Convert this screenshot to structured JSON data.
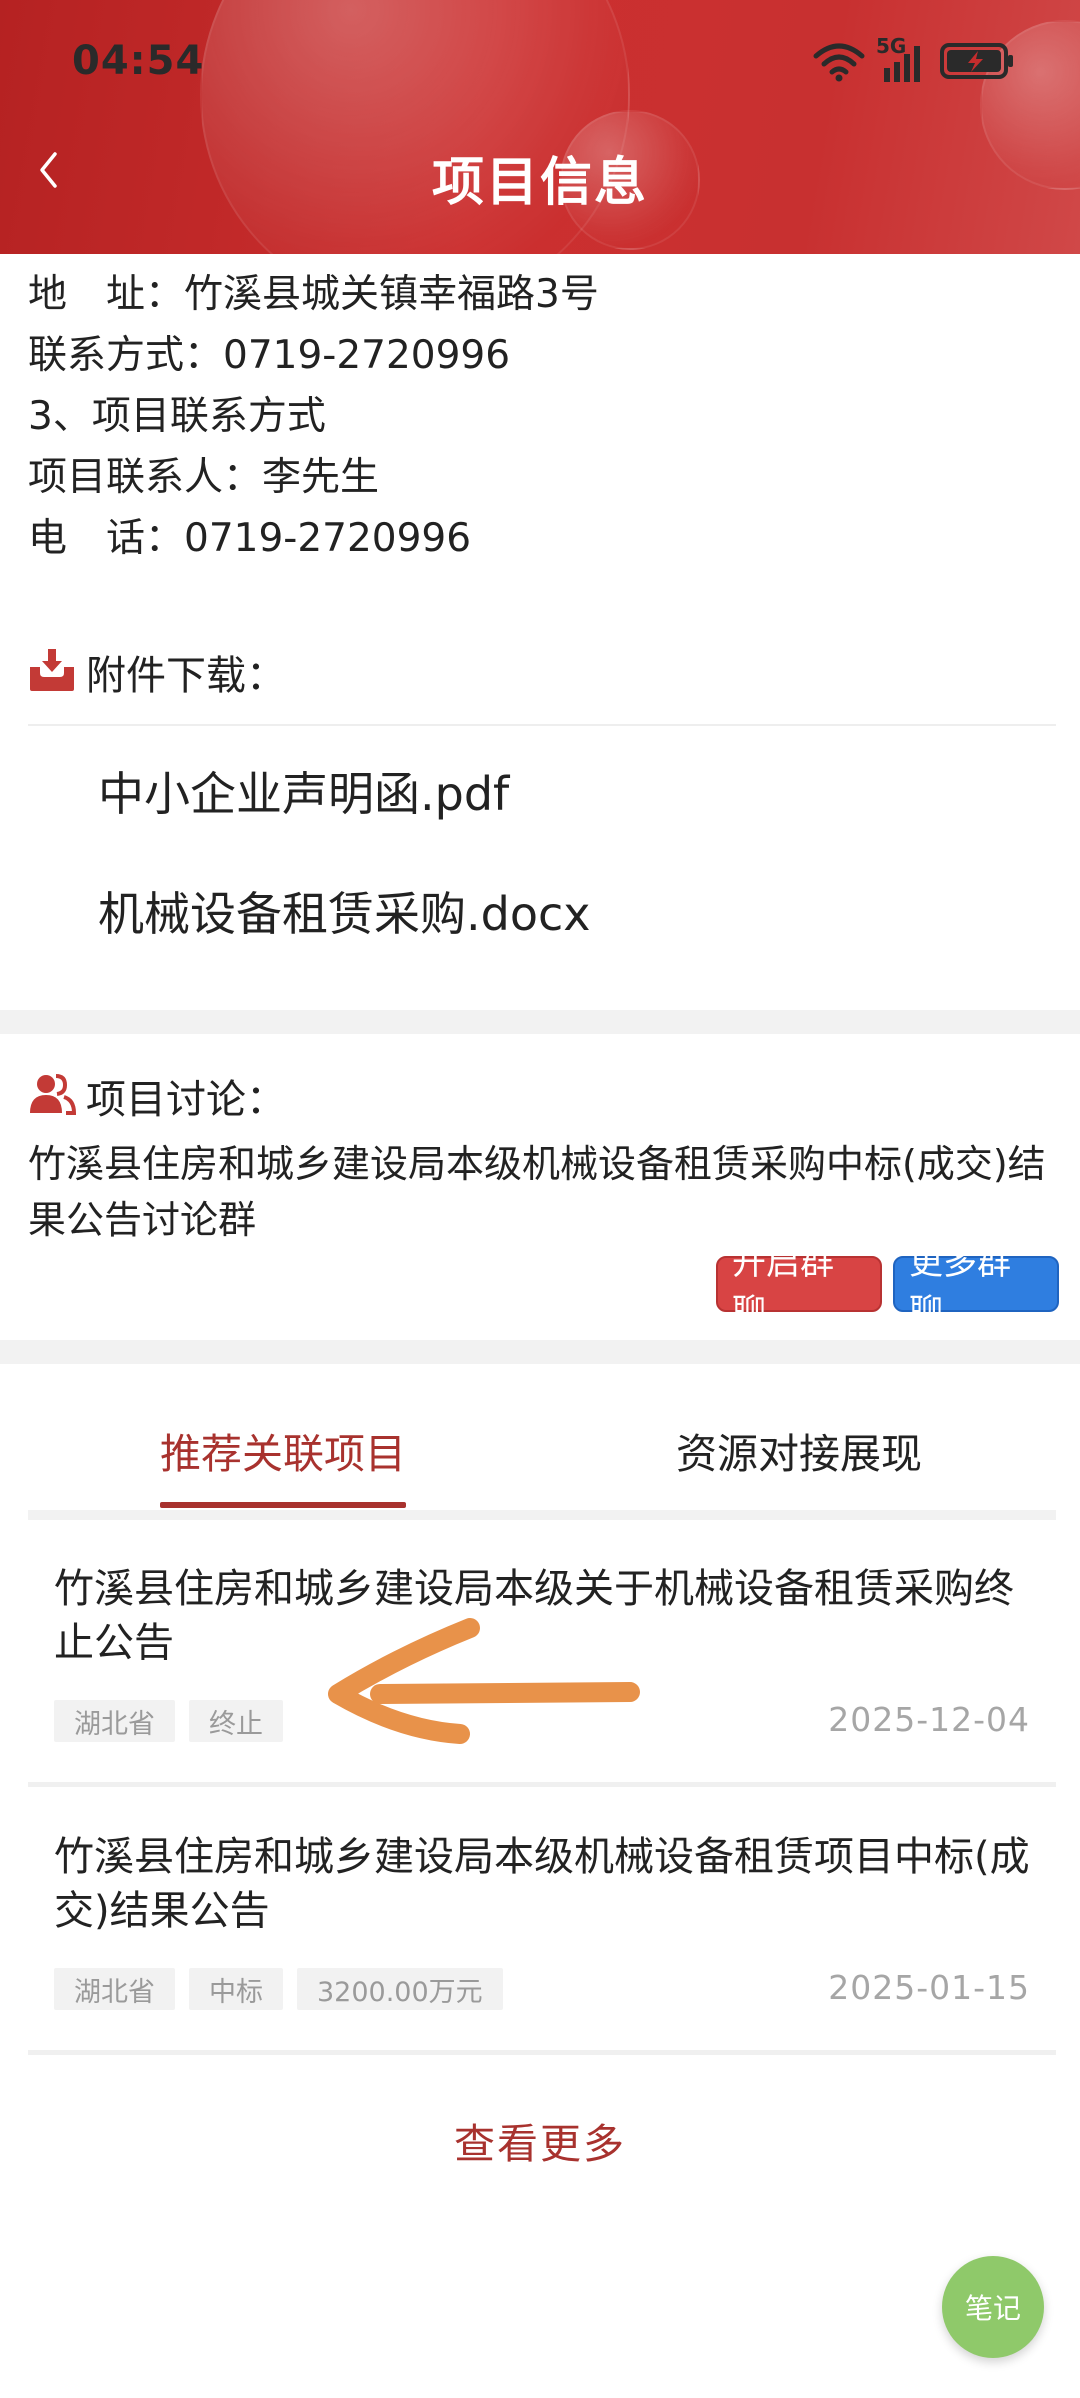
{
  "status_bar": {
    "time": "04:54",
    "network": "5G"
  },
  "header": {
    "title": "项目信息"
  },
  "contact_lines": [
    "地　址：竹溪县城关镇幸福路3号",
    "联系方式：0719-2720996",
    "3、项目联系方式",
    "项目联系人：李先生",
    "电　话：0719-2720996"
  ],
  "attachments": {
    "label": "附件下载：",
    "files": [
      "中小企业声明函.pdf",
      "机械设备租赁采购.docx"
    ]
  },
  "discussion": {
    "label": "项目讨论：",
    "group_name": "竹溪县住房和城乡建设局本级机械设备租赁采购中标(成交)结果公告讨论群",
    "open_button": "开启群聊",
    "more_button": "更多群聊"
  },
  "tabs": [
    {
      "label": "推荐关联项目",
      "active": true
    },
    {
      "label": "资源对接展现",
      "active": false
    }
  ],
  "projects": [
    {
      "title": "竹溪县住房和城乡建设局本级关于机械设备租赁采购终止公告",
      "tags": [
        "湖北省",
        "终止"
      ],
      "date": "2025-12-04"
    },
    {
      "title": "竹溪县住房和城乡建设局本级机械设备租赁项目中标(成交)结果公告",
      "tags": [
        "湖北省",
        "中标",
        "3200.00万元"
      ],
      "date": "2025-01-15"
    }
  ],
  "more_link": "查看更多",
  "note_button": "笔记",
  "colors": {
    "header_red": "#c62d2d",
    "accent": "#a8322e",
    "chip_red": "#d84444",
    "chip_blue": "#2f7ee0",
    "fab_green": "#8fc96a",
    "annotation_orange": "#e8924a"
  }
}
